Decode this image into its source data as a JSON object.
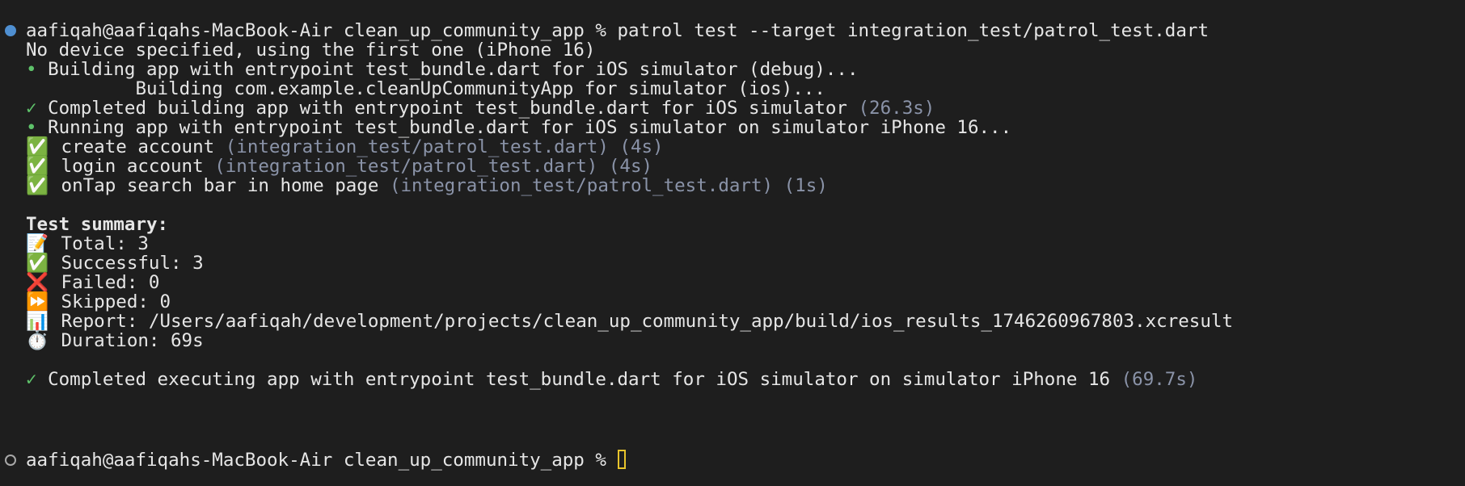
{
  "accent_colors": {
    "check_green": "#5ec26a",
    "dim": "#8a93a8",
    "cursor": "#e8c42c",
    "marker_blue": "#4f8fd1"
  },
  "prompt1": {
    "prompt": "aafiqah@aafiqahs-MacBook-Air clean_up_community_app % ",
    "command": "patrol test --target integration_test/patrol_test.dart"
  },
  "lines": {
    "no_device": "No device specified, using the first one (iPhone 16)",
    "building": "Building app with entrypoint test_bundle.dart for iOS simulator (debug)...",
    "building_sub": "        Building com.example.cleanUpCommunityApp for simulator (ios)...",
    "completed_build": "Completed building app with entrypoint test_bundle.dart for iOS simulator ",
    "completed_build_time": "(26.3s)",
    "running": "Running app with entrypoint test_bundle.dart for iOS simulator on simulator iPhone 16..."
  },
  "tests": [
    {
      "icon": "✅",
      "name": "create account ",
      "path": "(integration_test/patrol_test.dart) (4s)"
    },
    {
      "icon": "✅",
      "name": "login account ",
      "path": "(integration_test/patrol_test.dart) (4s)"
    },
    {
      "icon": "✅",
      "name": "onTap search bar in home page ",
      "path": "(integration_test/patrol_test.dart) (1s)"
    }
  ],
  "summary": {
    "heading": "Test summary:",
    "total": {
      "icon": "📝",
      "text": "Total: 3"
    },
    "successful": {
      "icon": "✅",
      "text": "Successful: 3"
    },
    "failed": {
      "icon": "❌",
      "text": "Failed: 0"
    },
    "skipped": {
      "icon": "⏩",
      "text": "Skipped: 0"
    },
    "report": {
      "icon": "📊",
      "text": "Report: /Users/aafiqah/development/projects/clean_up_community_app/build/ios_results_1746260967803.xcresult"
    },
    "duration": {
      "icon": "⏱️",
      "text": "Duration: 69s"
    }
  },
  "completed_exec": {
    "text": "Completed executing app with entrypoint test_bundle.dart for iOS simulator on simulator iPhone 16 ",
    "time": "(69.7s)"
  },
  "prompt2": {
    "prompt": "aafiqah@aafiqahs-MacBook-Air clean_up_community_app % "
  },
  "glyphs": {
    "bullet": "•",
    "check": "✓"
  }
}
